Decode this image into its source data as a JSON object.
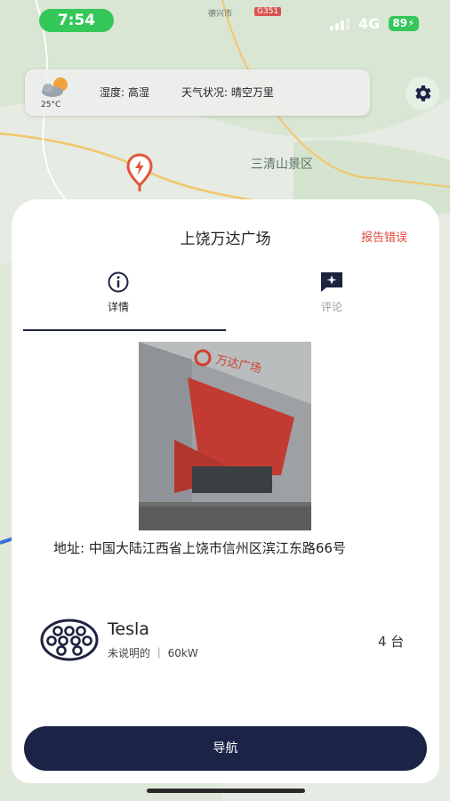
{
  "status_bar": {
    "time": "7:54",
    "network": "4G",
    "battery": "89"
  },
  "map": {
    "city_label": "德兴市",
    "road_label": "G351",
    "place_label": "三清山景区"
  },
  "weather": {
    "temperature": "25°C",
    "humidity": "湿度: 高湿",
    "condition": "天气状况: 晴空万里"
  },
  "icons": {
    "settings": "gear-icon",
    "pin": "charging-pin-icon",
    "info": "info-icon",
    "comment": "comment-icon",
    "connector": "ev-connector-icon"
  },
  "sheet": {
    "title": "上饶万达广场",
    "report_label": "报告错误",
    "tabs": [
      {
        "label": "详情"
      },
      {
        "label": "评论"
      }
    ],
    "photo_sign": "万达广场",
    "address": "地址: 中国大陆江西省上饶市信州区滨江东路66号",
    "charger": {
      "brand": "Tesla",
      "details": "未说明的 ｜ 60kW",
      "count": "4 台"
    },
    "navigate_label": "导航"
  },
  "colors": {
    "accent_dark": "#1b2346",
    "report_red": "#e24a3b",
    "status_green": "#34c759"
  }
}
